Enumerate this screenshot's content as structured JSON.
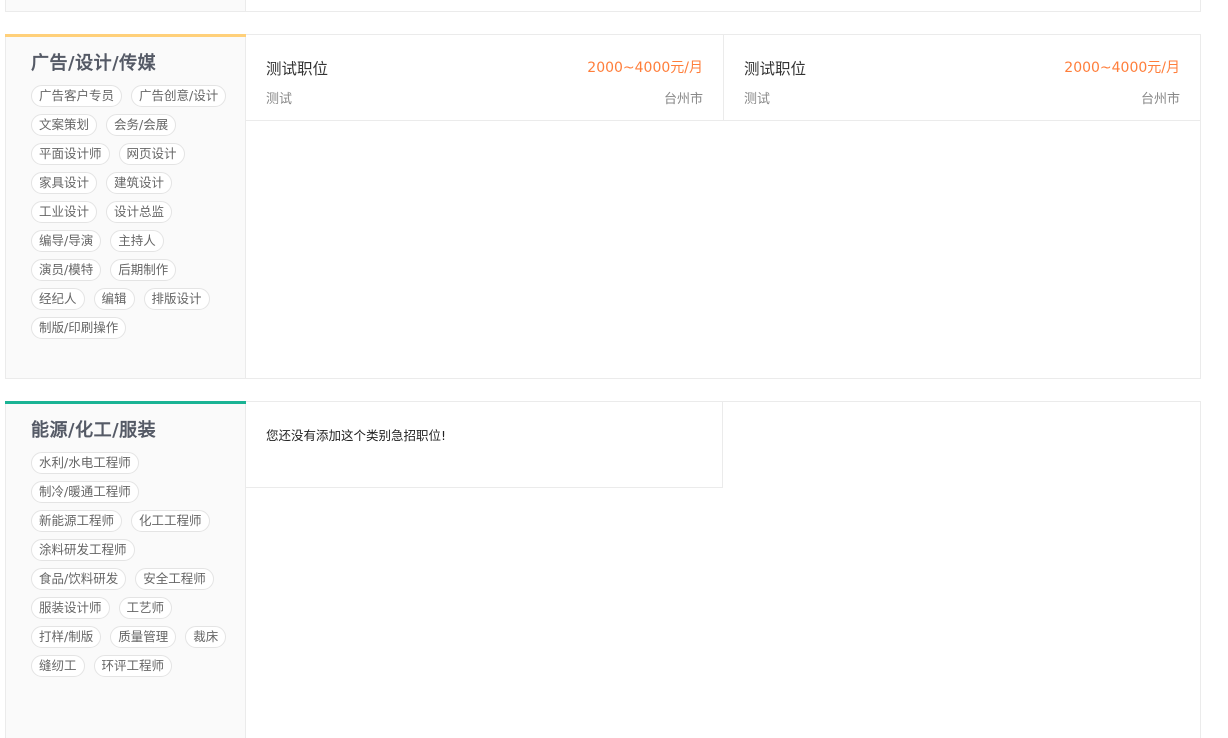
{
  "categories": [
    {
      "title": "广告/设计/传媒",
      "accent": "#ffd07a",
      "tags": [
        "广告客户专员",
        "广告创意/设计",
        "文案策划",
        "会务/会展",
        "平面设计师",
        "网页设计",
        "家具设计",
        "建筑设计",
        "工业设计",
        "设计总监",
        "编导/导演",
        "主持人",
        "演员/模特",
        "后期制作",
        "经纪人",
        "编辑",
        "排版设计",
        "制版/印刷操作"
      ],
      "jobs": [
        {
          "title": "测试职位",
          "salary": "2000~4000元/月",
          "company": "测试",
          "city": "台州市"
        },
        {
          "title": "测试职位",
          "salary": "2000~4000元/月",
          "company": "测试",
          "city": "台州市"
        }
      ]
    },
    {
      "title": "能源/化工/服装",
      "accent": "#1ab394",
      "tags": [
        "水利/水电工程师",
        "制冷/暖通工程师",
        "新能源工程师",
        "化工工程师",
        "涂料研发工程师",
        "食品/饮料研发",
        "安全工程师",
        "服装设计师",
        "工艺师",
        "打样/制版",
        "质量管理",
        "裁床",
        "缝纫工",
        "环评工程师"
      ],
      "empty_text": "您还没有添加这个类别急招职位!"
    }
  ]
}
